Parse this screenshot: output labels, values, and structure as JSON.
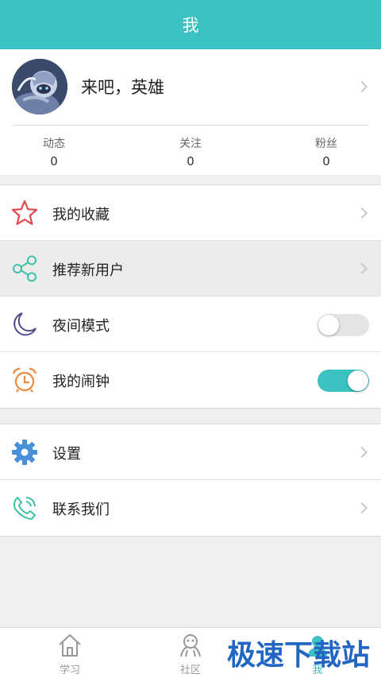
{
  "header": {
    "title": "我"
  },
  "profile": {
    "name": "来吧，英雄",
    "stats": [
      {
        "label": "动态",
        "value": "0"
      },
      {
        "label": "关注",
        "value": "0"
      },
      {
        "label": "粉丝",
        "value": "0"
      }
    ]
  },
  "menu_group_1": [
    {
      "label": "我的收藏",
      "icon": "star-icon",
      "color": "#e0474f"
    },
    {
      "label": "推荐新用户",
      "icon": "share-icon",
      "color": "#3dc2a8"
    },
    {
      "label": "夜间模式",
      "icon": "moon-icon",
      "color": "#4c4a8c",
      "toggle_on": false
    },
    {
      "label": "我的闹钟",
      "icon": "alarm-clock-icon",
      "color": "#ef8a3c",
      "toggle_on": true
    }
  ],
  "menu_group_2": [
    {
      "label": "设置",
      "icon": "gear-icon",
      "color": "#4a90d9"
    },
    {
      "label": "联系我们",
      "icon": "phone-icon",
      "color": "#3dc2a8"
    }
  ],
  "tabbar": {
    "tabs": [
      {
        "label": "学习",
        "icon": "home-icon"
      },
      {
        "label": "社区",
        "icon": "community-icon"
      },
      {
        "label": "我",
        "icon": "user-icon"
      }
    ],
    "active": "我"
  },
  "watermark": "极速下载站",
  "colors": {
    "accent": "#3dc2c4",
    "watermark": "#2266c4"
  }
}
